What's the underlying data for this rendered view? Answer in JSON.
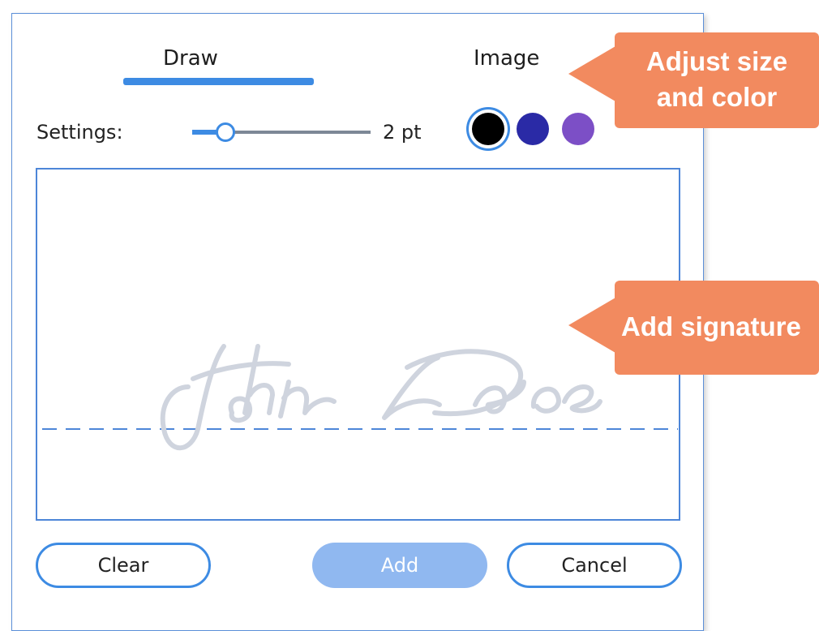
{
  "tabs": {
    "draw": "Draw",
    "image": "Image"
  },
  "settings": {
    "label": "Settings:",
    "size_value": "2 pt",
    "size_fraction": 0.18,
    "colors": [
      {
        "name": "black",
        "hex": "#000000",
        "selected": true
      },
      {
        "name": "dark-blue",
        "hex": "#2a2aa6",
        "selected": false
      },
      {
        "name": "purple",
        "hex": "#7c4fc6",
        "selected": false
      }
    ]
  },
  "canvas": {
    "signature_placeholder": "John Doe"
  },
  "buttons": {
    "clear": "Clear",
    "add": "Add",
    "cancel": "Cancel"
  },
  "callouts": {
    "size_color": "Adjust size\nand color",
    "signature": "Add signature"
  },
  "theme": {
    "accent": "#3d8be3",
    "callout": "#f28a5f"
  }
}
